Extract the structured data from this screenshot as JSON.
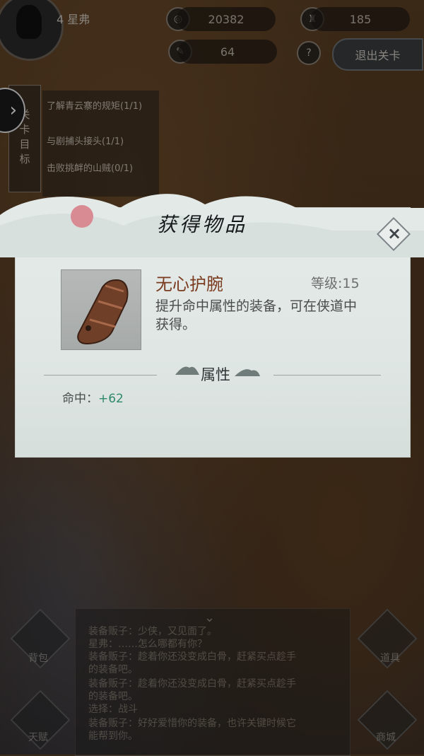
{
  "hud": {
    "player_name": "4 星弗",
    "currency_1": "20382",
    "currency_2": "185",
    "stamina": "64",
    "help_icon": "?",
    "exit_label": "退出关卡"
  },
  "quest_panel": {
    "tab_label": "关卡目标",
    "items": [
      {
        "text": "了解青云寨的规矩",
        "progress": "(1/1)"
      },
      {
        "text": "与剧捕头接头",
        "progress": "(1/1)"
      },
      {
        "text": "击败挑衅的山贼",
        "progress": "(0/1)"
      }
    ]
  },
  "modal": {
    "title": "获得物品",
    "close_glyph": "×",
    "item_name": "无心护腕",
    "level_label": "等级:15",
    "description": "提升命中属性的装备，可在侠道中获得。",
    "section_title": "属性",
    "stat_label": "命中：",
    "stat_value": "+62"
  },
  "bottom": {
    "left_buttons": [
      "背包",
      "天赋"
    ],
    "right_buttons": [
      "道具",
      "商城"
    ],
    "dialog_lines": [
      "装备贩子：少侠，又见面了。",
      "星弗：……怎么哪都有你？",
      "装备贩子：趁着你还没变成白骨，赶紧买点趁手",
      "的装备吧。",
      "装备贩子：趁着你还没变成白骨，赶紧买点趁手",
      "的装备吧。",
      "选择：战斗",
      "装备贩子：好好爱惜你的装备，也许关键时候它",
      "能帮到你。"
    ]
  },
  "colors": {
    "item_name": "#7a3a1e",
    "stat_value": "#2e8a6a"
  }
}
